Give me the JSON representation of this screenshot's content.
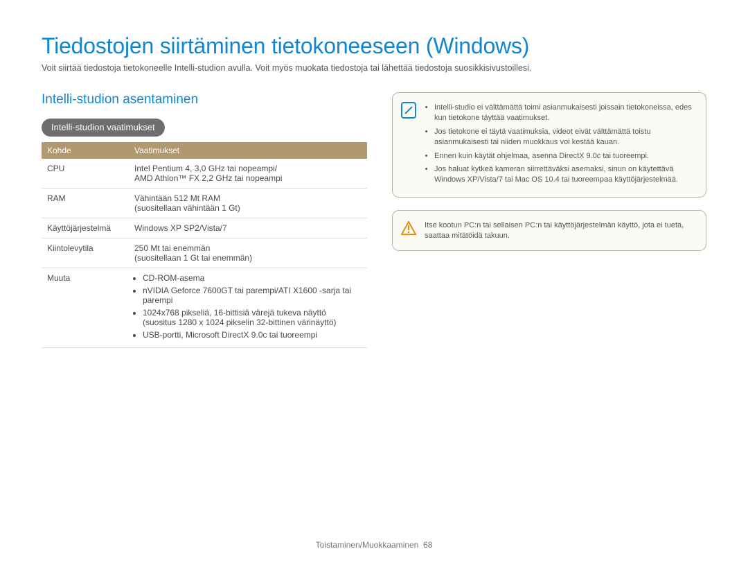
{
  "page_title": "Tiedostojen siirtäminen tietokoneeseen (Windows)",
  "intro": "Voit siirtää tiedostoja tietokoneelle Intelli-studion avulla. Voit myös muokata tiedostoja tai lähettää tiedostoja suosikkisivustoillesi.",
  "section_h2": "Intelli-studion asentaminen",
  "pill_label": "Intelli-studion vaatimukset",
  "table": {
    "col1": "Kohde",
    "col2": "Vaatimukset",
    "rows": {
      "cpu_label": "CPU",
      "cpu_line1": "Intel Pentium 4, 3,0 GHz tai nopeampi/",
      "cpu_line2": "AMD Athlon™ FX 2,2 GHz tai nopeampi",
      "ram_label": "RAM",
      "ram_line1": "Vähintään 512 Mt RAM",
      "ram_line2": "(suositellaan vähintään 1 Gt)",
      "os_label": "Käyttöjärjestelmä",
      "os_value": "Windows XP SP2/Vista/7",
      "hdd_label": "Kiintolevytila",
      "hdd_line1": "250 Mt tai enemmän",
      "hdd_line2": "(suositellaan 1 Gt tai enemmän)",
      "other_label": "Muuta",
      "other_items": {
        "a": "CD-ROM-asema",
        "b": "nVIDIA Geforce 7600GT tai parempi/ATI X1600 -sarja tai parempi",
        "c": "1024x768 pikseliä, 16-bittisiä värejä tukeva näyttö (suositus 1280 x 1024 pikselin 32-bittinen värinäyttö)",
        "d": "USB-portti, Microsoft DirectX 9.0c tai tuoreempi"
      }
    }
  },
  "note": {
    "items": {
      "a": "Intelli-studio ei välttämättä toimi asianmukaisesti joissain tietokoneissa, edes kun tietokone täyttää vaatimukset.",
      "b": "Jos tietokone ei täytä vaatimuksia, videot eivät välttämättä toistu asianmukaisesti tai niiden muokkaus voi kestää kauan.",
      "c": "Ennen kuin käytät ohjelmaa, asenna DirectX 9.0c tai tuoreempi.",
      "d": "Jos haluat kytkeä kameran siirrettäväksi asemaksi, sinun on käytettävä Windows XP/Vista/7 tai Mac OS 10.4 tai tuoreempaa käyttöjärjestelmää."
    }
  },
  "warning": "Itse kootun PC:n tai sellaisen PC:n tai käyttöjärjestelmän käyttö, jota ei tueta, saattaa mitätöidä takuun.",
  "footer_label": "Toistaminen/Muokkaaminen",
  "footer_page": "68"
}
